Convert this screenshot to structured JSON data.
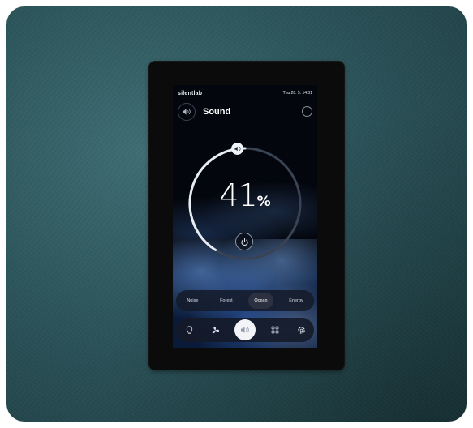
{
  "device": {
    "brand": "silentlab",
    "datetime": "Thu 26. 5. 14:31"
  },
  "header": {
    "title": "Sound",
    "info_label": "i"
  },
  "volume": {
    "value": 41,
    "display": "41",
    "unit": "%"
  },
  "modes": [
    {
      "label": "Noise",
      "active": false
    },
    {
      "label": "Forest",
      "active": false
    },
    {
      "label": "Ocean",
      "active": true
    },
    {
      "label": "Energy",
      "active": false
    }
  ],
  "nav": [
    {
      "icon": "bulb-icon",
      "active": false
    },
    {
      "icon": "fan-icon",
      "active": false
    },
    {
      "icon": "sound-icon",
      "active": true
    },
    {
      "icon": "grid-icon",
      "active": false
    },
    {
      "icon": "gear-icon",
      "active": false
    }
  ],
  "colors": {
    "wall": "#2c555b",
    "bezel": "#0b0b0c",
    "screen": "#03060d",
    "accent": "#f0f3f8"
  }
}
